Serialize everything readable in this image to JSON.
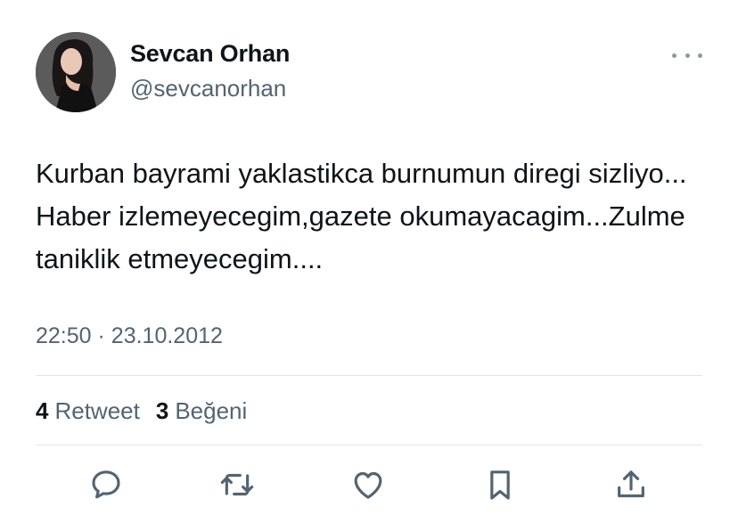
{
  "user": {
    "name": "Sevcan Orhan",
    "handle": "@sevcanorhan"
  },
  "tweet": {
    "text": "Kurban bayrami yaklastikca burnumun diregi sizliyo... Haber izlemeyecegim,gazete okumayacagim...Zulme taniklik etmeyecegim....",
    "time": "22:50",
    "separator": "·",
    "date": "23.10.2012"
  },
  "stats": {
    "retweets_count": "4",
    "retweets_label": "Retweet",
    "likes_count": "3",
    "likes_label": "Beğeni"
  },
  "icons": {
    "more": "more-horizontal-icon",
    "reply": "reply-bubble-icon",
    "retweet": "retweet-icon",
    "like": "heart-icon",
    "bookmark": "bookmark-icon",
    "share": "share-upload-icon"
  },
  "colors": {
    "text_primary": "#0f1419",
    "text_secondary": "#536471",
    "divider": "#e1e5e8"
  }
}
